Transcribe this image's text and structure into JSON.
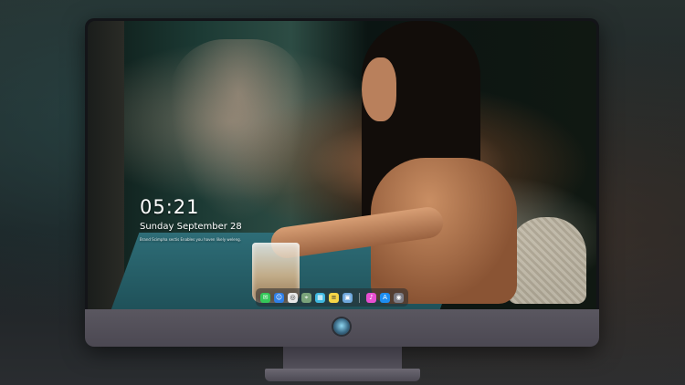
{
  "lock_screen": {
    "time": "05:21",
    "date": "Sunday September  28",
    "notice": "Brand Scimpha sectis Enables you haven likely weleng."
  },
  "dock": {
    "items": [
      {
        "name": "messages-icon",
        "glyph": "✉",
        "color": "#34c759"
      },
      {
        "name": "finder-icon",
        "glyph": "☺",
        "color": "#2f7fe6"
      },
      {
        "name": "safari-icon",
        "glyph": "◎",
        "color": "#e8e8e8"
      },
      {
        "name": "maps-icon",
        "glyph": "⌖",
        "color": "#7aa37a"
      },
      {
        "name": "photos-icon",
        "glyph": "▦",
        "color": "#3fb8e0"
      },
      {
        "name": "notes-icon",
        "glyph": "≡",
        "color": "#f5d547"
      },
      {
        "name": "preview-icon",
        "glyph": "▣",
        "color": "#6fa8dc"
      },
      {
        "name": "music-icon",
        "glyph": "♪",
        "color": "#e84fd1"
      },
      {
        "name": "app-store-icon",
        "glyph": "A",
        "color": "#1d8df0"
      },
      {
        "name": "camera-icon",
        "glyph": "◉",
        "color": "#7b7b84"
      }
    ]
  }
}
